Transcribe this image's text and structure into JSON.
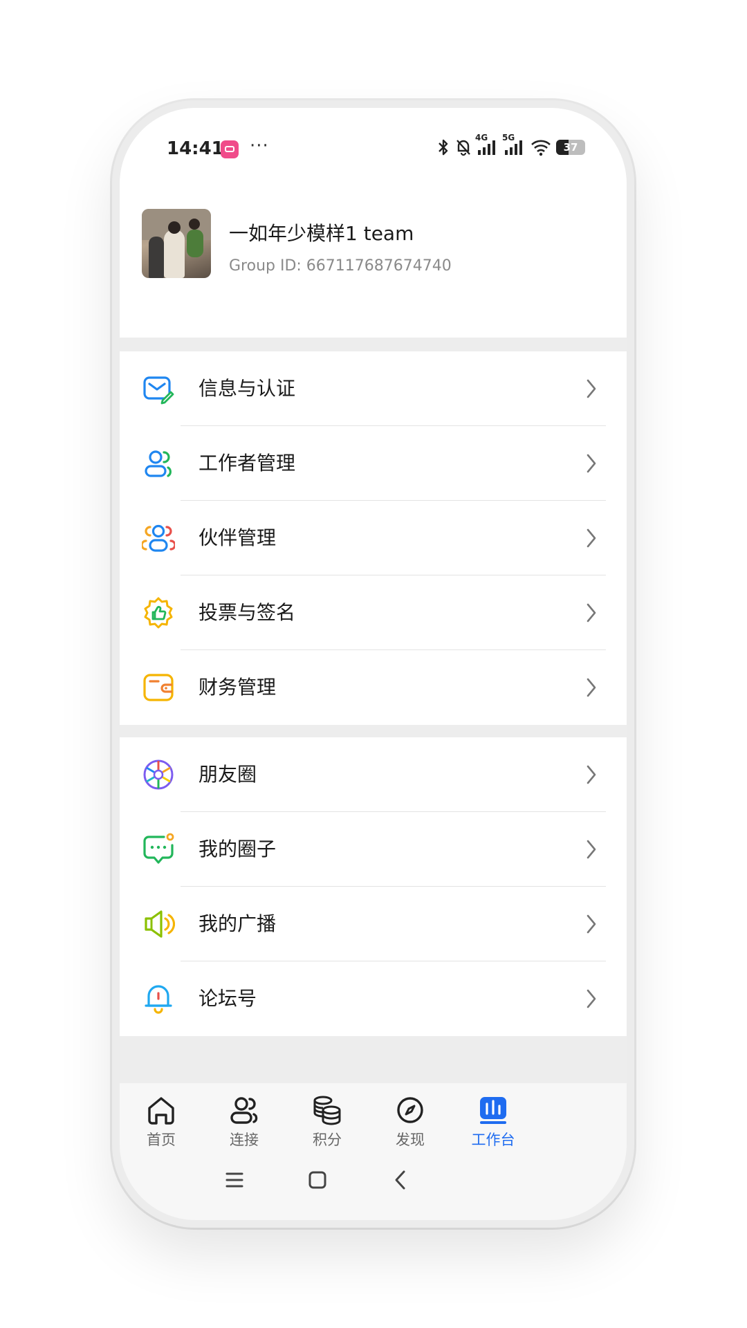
{
  "status_bar": {
    "time": "14:41",
    "dots": "···",
    "network_4g": "4G",
    "network_5g": "5G",
    "battery": "37"
  },
  "group": {
    "name": "一如年少模样1 team",
    "id_text": "Group ID: 667117687674740"
  },
  "menu_section_1": [
    {
      "label": "信息与认证",
      "icon": "mail-verify-icon"
    },
    {
      "label": "工作者管理",
      "icon": "workers-icon"
    },
    {
      "label": "伙伴管理",
      "icon": "partners-icon"
    },
    {
      "label": "投票与签名",
      "icon": "vote-thumb-icon"
    },
    {
      "label": "财务管理",
      "icon": "wallet-icon"
    }
  ],
  "menu_section_2": [
    {
      "label": "朋友圈",
      "icon": "moments-aperture-icon"
    },
    {
      "label": "我的圈子",
      "icon": "chat-bubble-icon"
    },
    {
      "label": "我的广播",
      "icon": "megaphone-icon"
    },
    {
      "label": "论坛号",
      "icon": "bell-icon"
    }
  ],
  "bottom_nav": [
    {
      "label": "首页",
      "icon": "home-icon"
    },
    {
      "label": "连接",
      "icon": "connect-users-icon"
    },
    {
      "label": "积分",
      "icon": "coins-icon"
    },
    {
      "label": "发现",
      "icon": "compass-icon"
    },
    {
      "label": "工作台",
      "icon": "dashboard-icon",
      "active": true
    }
  ],
  "colors": {
    "accent": "#1f6cf0",
    "text_primary": "#1a1a1a",
    "text_secondary": "#8a8a8a"
  }
}
